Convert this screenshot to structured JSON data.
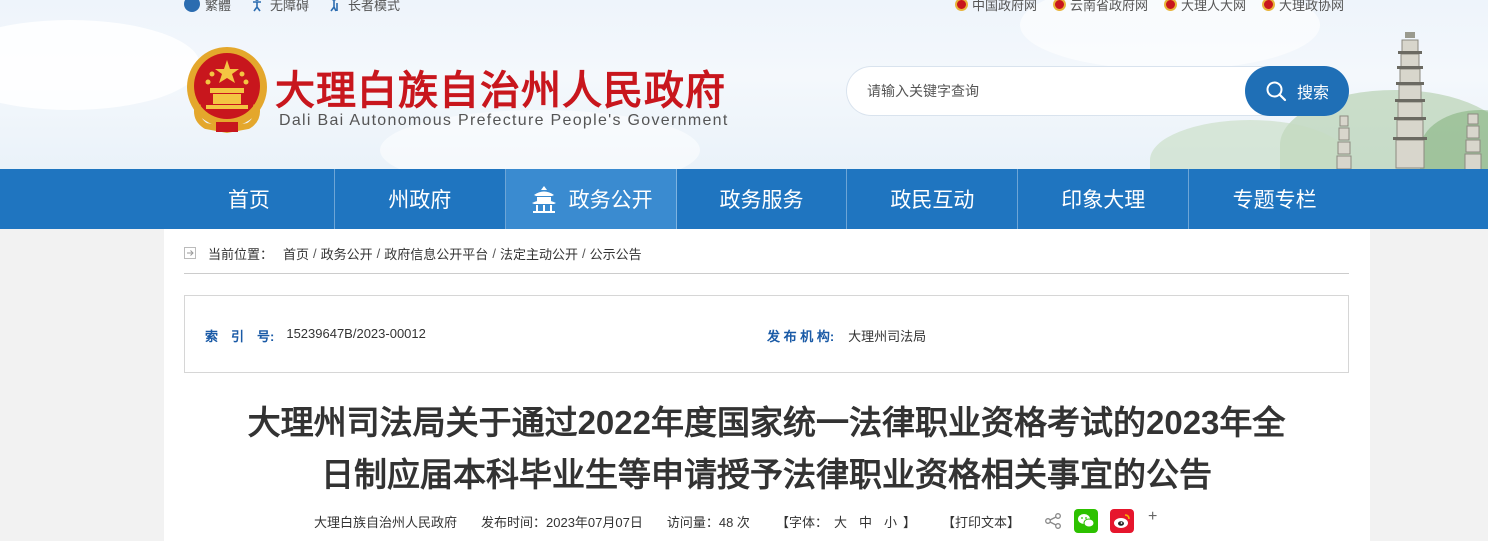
{
  "top_links_left": [
    {
      "label": "繁體",
      "icon": "globe-icon"
    },
    {
      "label": "无障碍",
      "icon": "accessibility-icon"
    },
    {
      "label": "长者模式",
      "icon": "elder-icon"
    }
  ],
  "top_links_right": [
    {
      "label": "中国政府网"
    },
    {
      "label": "云南省政府网"
    },
    {
      "label": "大理人大网"
    },
    {
      "label": "大理政协网"
    }
  ],
  "site": {
    "title": "大理白族自治州人民政府",
    "subtitle": "Dali Bai Autonomous Prefecture People's Government"
  },
  "search": {
    "placeholder": "请输入关键字查询",
    "button": "搜索"
  },
  "nav": {
    "items": [
      "首页",
      "州政府",
      "政务公开",
      "政务服务",
      "政民互动",
      "印象大理",
      "专题专栏"
    ],
    "active_index": 2
  },
  "breadcrumb": {
    "label": "当前位置：",
    "items": [
      "首页",
      "政务公开",
      "政府信息公开平台",
      "法定主动公开",
      "公示公告"
    ]
  },
  "meta": {
    "index_label": "索　引　号:",
    "index_value": "15239647B/2023-00012",
    "publisher_label": "发 布 机 构:",
    "publisher_value": "大理州司法局"
  },
  "article": {
    "title_line1": "大理州司法局关于通过2022年度国家统一法律职业资格考试的2023年全",
    "title_line2": "日制应届本科毕业生等申请授予法律职业资格相关事宜的公告",
    "source": "大理白族自治州人民政府",
    "date": "发布时间：2023年07月07日",
    "views": "访问量：48 次",
    "font_label": "【字体：",
    "font_large": "大",
    "font_medium": "中",
    "font_small": "小",
    "font_close": "】",
    "print": "【打印文本】",
    "more": "+"
  },
  "colors": {
    "brand_red": "#c8161d",
    "nav_blue": "#1f75c0",
    "nav_active": "#3a8bd0",
    "search_blue": "#1f6fb6",
    "meta_label_blue": "#1a5aa6",
    "wechat_green": "#2dc100",
    "weibo_red": "#e6162d"
  }
}
